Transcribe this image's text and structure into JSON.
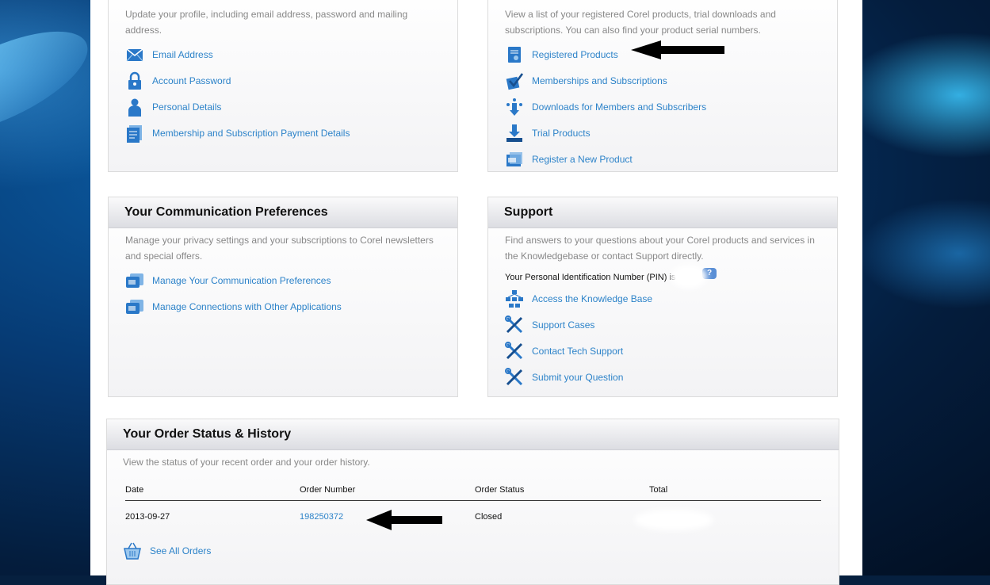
{
  "account": {
    "desc": "Update your profile, including email address, password and mailing address.",
    "links": [
      {
        "label": "Email Address"
      },
      {
        "label": "Account Password"
      },
      {
        "label": "Personal Details"
      },
      {
        "label": "Membership and Subscription Payment Details"
      }
    ]
  },
  "products": {
    "desc": "View a list of your registered Corel products, trial downloads and subscriptions. You can also find your product serial numbers.",
    "links": [
      {
        "label": "Registered Products"
      },
      {
        "label": "Memberships and Subscriptions"
      },
      {
        "label": "Downloads for Members and Subscribers"
      },
      {
        "label": "Trial Products"
      },
      {
        "label": "Register a New Product"
      }
    ]
  },
  "communication": {
    "title": "Your Communication Preferences",
    "desc": "Manage your privacy settings and your subscriptions to Corel newsletters and special offers.",
    "links": [
      {
        "label": "Manage Your Communication Preferences"
      },
      {
        "label": "Manage Connections with Other Applications"
      }
    ]
  },
  "support": {
    "title": "Support",
    "desc": "Find answers to your questions about your Corel products and services in the Knowledgebase or contact Support directly.",
    "pin_label": "Your Personal Identification Number (PIN) is",
    "help_glyph": "?",
    "links": [
      {
        "label": "Access the Knowledge Base"
      },
      {
        "label": "Support Cases"
      },
      {
        "label": "Contact Tech Support"
      },
      {
        "label": "Submit your Question"
      }
    ]
  },
  "orders": {
    "title": "Your Order Status & History",
    "desc": "View the status of your recent order and your order history.",
    "columns": [
      "Date",
      "Order Number",
      "Order Status",
      "Total"
    ],
    "rows": [
      {
        "date": "2013-09-27",
        "order_number": "198250372",
        "status": "Closed",
        "total": ""
      }
    ],
    "see_all": "See All Orders"
  },
  "colors": {
    "link": "#2d83c9",
    "icon_blue": "#2a78c8",
    "background_blue": "#063a73"
  }
}
